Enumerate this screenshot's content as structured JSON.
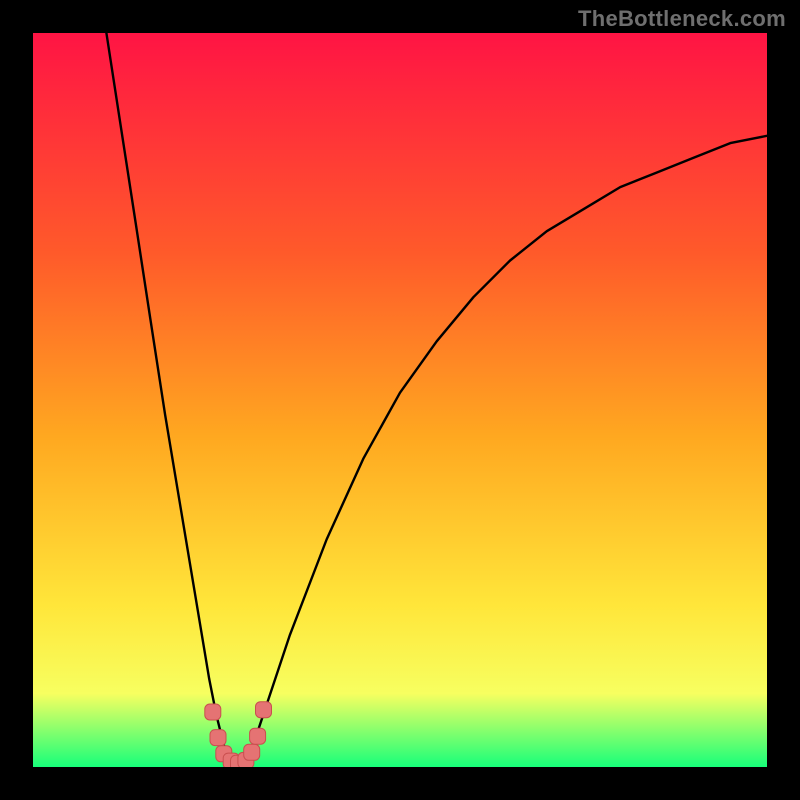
{
  "watermark": "TheBottleneck.com",
  "colors": {
    "frame": "#000000",
    "watermark": "#6f6f6f",
    "curve": "#000000",
    "marker_fill": "#e57373",
    "marker_stroke": "#c94f4f",
    "gradient": {
      "top": "#ff1444",
      "mid1": "#ff5a2a",
      "mid2": "#ffa820",
      "mid3": "#ffe63a",
      "lowband": "#f7ff60",
      "bottom": "#17ff7a"
    }
  },
  "chart_data": {
    "type": "line",
    "title": "",
    "xlabel": "",
    "ylabel": "",
    "xlim": [
      0,
      100
    ],
    "ylim": [
      0,
      100
    ],
    "series": [
      {
        "name": "bottleneck-curve",
        "x": [
          10,
          12,
          14,
          16,
          18,
          20,
          22,
          24,
          25,
          26,
          27,
          28,
          29,
          30,
          32,
          35,
          40,
          45,
          50,
          55,
          60,
          65,
          70,
          75,
          80,
          85,
          90,
          95,
          100
        ],
        "y": [
          100,
          87,
          74,
          61,
          48,
          36,
          24,
          12,
          7,
          3,
          1,
          0,
          1,
          3,
          9,
          18,
          31,
          42,
          51,
          58,
          64,
          69,
          73,
          76,
          79,
          81,
          83,
          85,
          86
        ]
      }
    ],
    "markers": {
      "name": "bottom-cluster",
      "x": [
        24.5,
        25.2,
        26.0,
        27.0,
        28.0,
        29.0,
        29.8,
        30.6,
        31.4
      ],
      "y": [
        7.5,
        4.0,
        1.8,
        0.8,
        0.5,
        0.9,
        2.0,
        4.2,
        7.8
      ]
    }
  }
}
